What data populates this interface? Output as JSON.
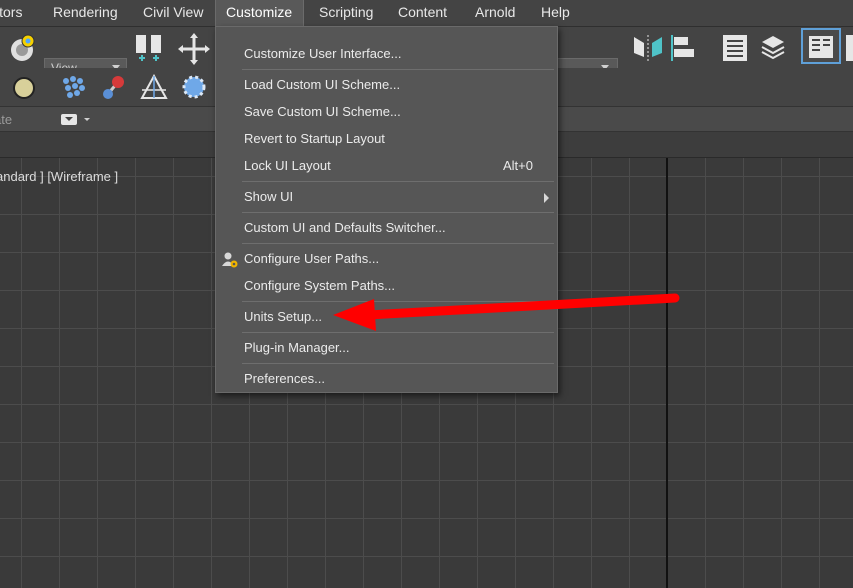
{
  "menubar": {
    "items": [
      {
        "label": "itors"
      },
      {
        "label": "Rendering"
      },
      {
        "label": "Civil View"
      },
      {
        "label": "Customize"
      },
      {
        "label": "Scripting"
      },
      {
        "label": "Content"
      },
      {
        "label": "Arnold"
      },
      {
        "label": "Help"
      }
    ],
    "active_index": 3
  },
  "toolbar": {
    "view_dropdown": "View"
  },
  "ribbon": {
    "label": "ate"
  },
  "viewport": {
    "label": "andard ] [Wireframe ]"
  },
  "customize_menu": {
    "customize_ui": "Customize User Interface...",
    "load_scheme": "Load Custom UI Scheme...",
    "save_scheme": "Save Custom UI Scheme...",
    "revert_layout": "Revert to Startup Layout",
    "lock_layout": "Lock UI Layout",
    "lock_shortcut": "Alt+0",
    "show_ui": "Show UI",
    "switcher": "Custom UI and Defaults Switcher...",
    "user_paths": "Configure User Paths...",
    "system_paths": "Configure System Paths...",
    "units_setup": "Units Setup...",
    "plugin_manager": "Plug-in Manager...",
    "preferences": "Preferences..."
  },
  "colors": {
    "annotation_arrow": "#ff0000",
    "menu_bg": "#565656",
    "app_bg": "#444444"
  }
}
